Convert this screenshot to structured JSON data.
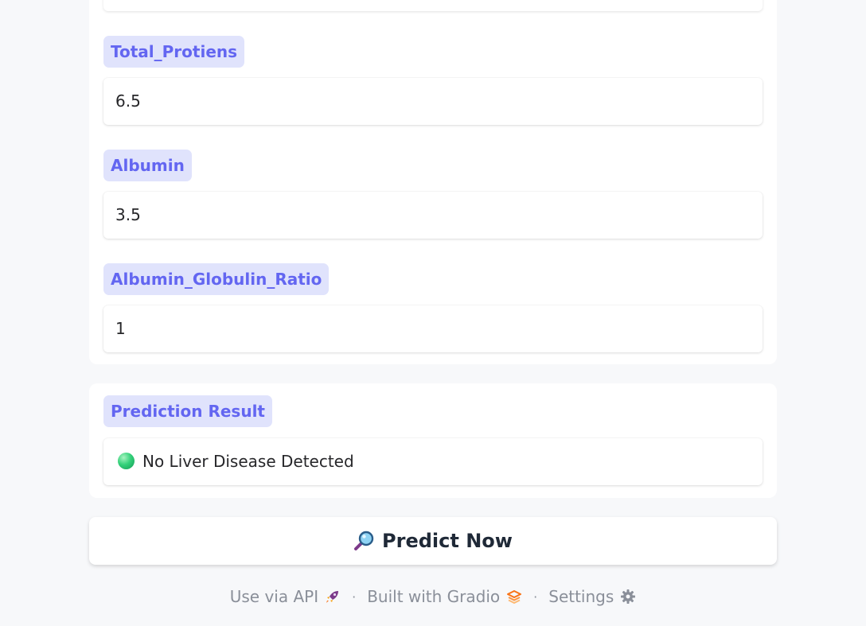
{
  "fields": [
    {
      "label": "Total_Protiens",
      "value": "6.5"
    },
    {
      "label": "Albumin",
      "value": "3.5"
    },
    {
      "label": "Albumin_Globulin_Ratio",
      "value": "1"
    }
  ],
  "result": {
    "label": "Prediction Result",
    "value": "No Liver Disease Detected",
    "status_icon": "green-circle-icon"
  },
  "predict_button": {
    "label": "Predict Now",
    "icon": "magnifying-glass-icon"
  },
  "footer": {
    "api_label": "Use via API",
    "api_icon": "rocket-icon",
    "separator": "·",
    "built_label": "Built with Gradio",
    "built_icon": "gradio-logo-icon",
    "settings_label": "Settings",
    "settings_icon": "gear-icon"
  },
  "colors": {
    "accent": "#6366f1",
    "label_background": "#e0e3fc",
    "page_background": "#f7f8fa",
    "status_green": "#34d17a"
  }
}
